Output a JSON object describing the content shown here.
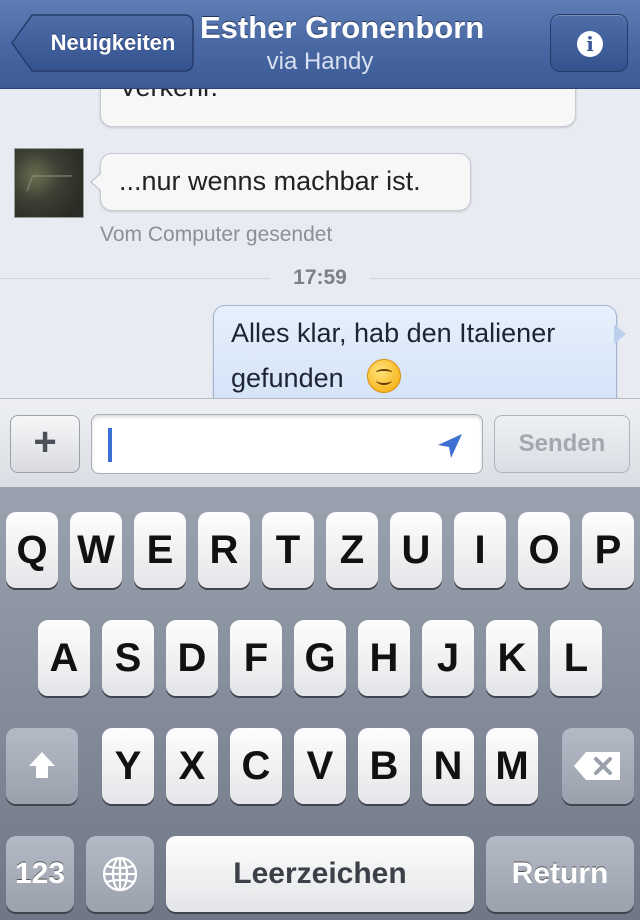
{
  "nav": {
    "back_label": "Neuigkeiten",
    "title": "Esther Gronenborn",
    "subtitle": "via Handy",
    "info_label": "i"
  },
  "chat": {
    "messages": [
      {
        "direction": "in",
        "text": "Verkehr."
      },
      {
        "direction": "in",
        "text": "...nur wenns machbar ist."
      }
    ],
    "meta": "Vom Computer gesendet",
    "time": "17:59",
    "outgoing": {
      "line1": "Alles klar, hab den Italiener",
      "line2": "gefunden",
      "emoji": "smiley-face"
    }
  },
  "input": {
    "plus_label": "+",
    "value": "",
    "send_label": "Senden"
  },
  "keyboard": {
    "row1": [
      "Q",
      "W",
      "E",
      "R",
      "T",
      "Z",
      "U",
      "I",
      "O",
      "P"
    ],
    "row2": [
      "A",
      "S",
      "D",
      "F",
      "G",
      "H",
      "J",
      "K",
      "L"
    ],
    "row3": [
      "Y",
      "X",
      "C",
      "V",
      "B",
      "N",
      "M"
    ],
    "numbers_label": "123",
    "space_label": "Leerzeichen",
    "return_label": "Return"
  },
  "colors": {
    "nav": "#4a68a3",
    "outgoing_bubble": "#cfe0f7",
    "caret": "#3a6fd8"
  }
}
